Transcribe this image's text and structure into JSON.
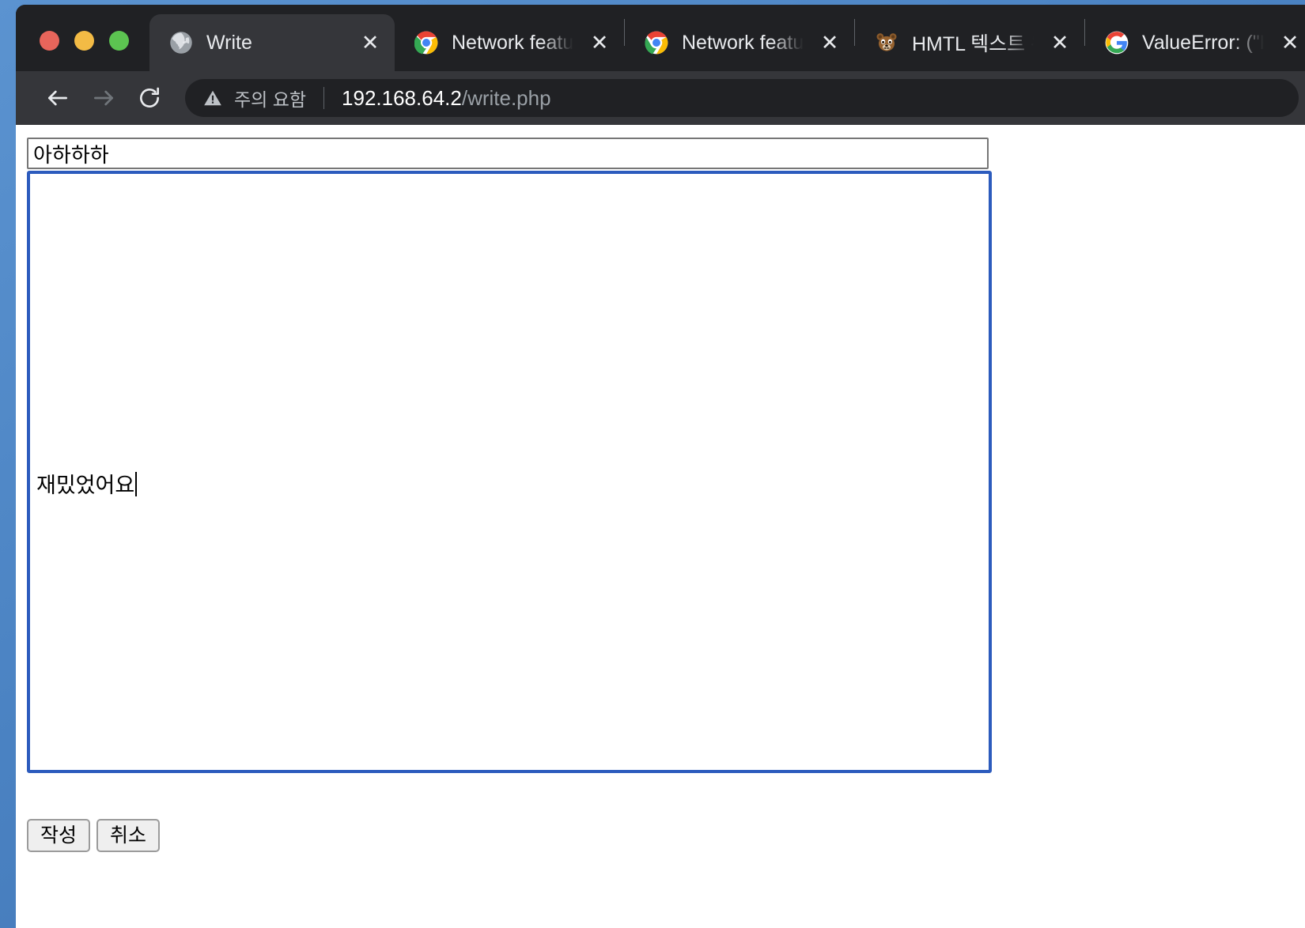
{
  "window": {
    "traffic_lights": [
      {
        "name": "close",
        "color": "#e8655b"
      },
      {
        "name": "minimize",
        "color": "#f3bb45"
      },
      {
        "name": "maximize",
        "color": "#5cc451"
      }
    ]
  },
  "tabs": [
    {
      "title": "Write",
      "favicon": "globe-icon",
      "active": true,
      "close_label": "✕"
    },
    {
      "title": "Network feature",
      "favicon": "chrome-icon",
      "active": false,
      "close_label": "✕"
    },
    {
      "title": "Network feature",
      "favicon": "chrome-icon",
      "active": false,
      "close_label": "✕"
    },
    {
      "title": "HMTL 텍스트 왼쪽",
      "favicon": "bear-icon",
      "active": false,
      "close_label": "✕"
    },
    {
      "title": "ValueError: (\"K",
      "favicon": "google-icon",
      "active": false,
      "close_label": "✕"
    }
  ],
  "toolbar": {
    "back_label": "back-arrow",
    "forward_label": "forward-arrow",
    "reload_label": "reload",
    "security_text": "주의 요함",
    "url_host": "192.168.64.2",
    "url_path": "/write.php",
    "url_full": "192.168.64.2/write.php"
  },
  "form": {
    "title_value": "아하하하",
    "title_placeholder": "",
    "content_value": "재밌었어요",
    "content_placeholder": "",
    "submit_label": "작성",
    "cancel_label": "취소"
  },
  "colors": {
    "tab_strip_bg": "#202124",
    "toolbar_bg": "#35363a",
    "active_tab_bg": "#35363a",
    "omnibox_bg": "#202124",
    "focus_border": "#2c5bbd",
    "page_bg": "#ffffff",
    "desktop": "#4a86c8"
  }
}
